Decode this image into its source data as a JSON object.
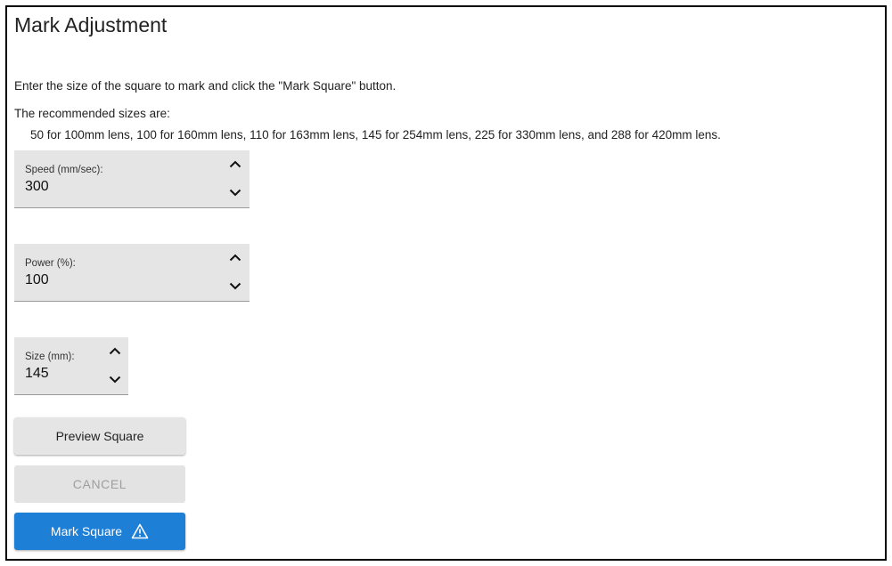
{
  "title": "Mark Adjustment",
  "instructions": "Enter the size of the square to mark and click the \"Mark Square\" button.",
  "recommended_label": "The recommended sizes are:",
  "recommended_sizes": "50 for 100mm lens, 100 for 160mm lens, 110 for 163mm lens, 145 for 254mm lens, 225 for 330mm lens, and 288 for 420mm lens.",
  "fields": {
    "speed": {
      "label": "Speed (mm/sec):",
      "value": "300"
    },
    "power": {
      "label": "Power (%):",
      "value": "100"
    },
    "size": {
      "label": "Size (mm):",
      "value": "145"
    }
  },
  "buttons": {
    "preview": "Preview Square",
    "cancel": "CANCEL",
    "mark": "Mark Square"
  },
  "icons": {
    "spin_up": "chevron-up-icon",
    "spin_down": "chevron-down-icon",
    "mark": "warning-icon"
  },
  "colors": {
    "primary": "#1e7fd6",
    "field_bg": "#e5e5e5",
    "disabled_text": "#9e9e9e"
  }
}
